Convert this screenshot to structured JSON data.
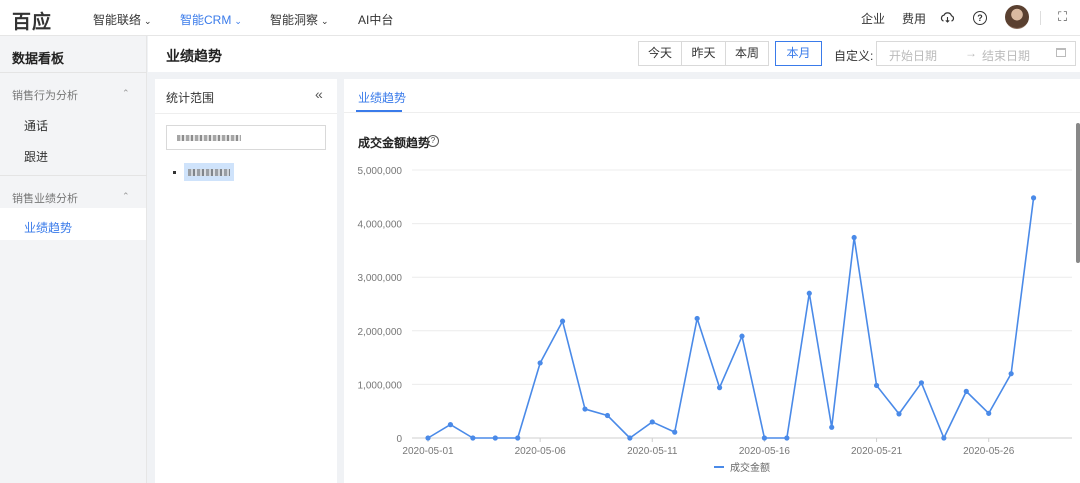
{
  "topbar": {
    "logo": "百应",
    "nav": [
      {
        "label": "智能联络",
        "active": false,
        "has_dropdown": true
      },
      {
        "label": "智能CRM",
        "active": true,
        "has_dropdown": true
      },
      {
        "label": "智能洞察",
        "active": false,
        "has_dropdown": true
      },
      {
        "label": "AI中台",
        "active": false,
        "has_dropdown": false
      }
    ],
    "right": {
      "enterprise": "企业",
      "fees": "费用",
      "icons": [
        "cloud-icon",
        "help-icon",
        "avatar",
        "expand-icon"
      ]
    }
  },
  "sidebar": {
    "title": "数据看板",
    "groups": [
      {
        "label": "销售行为分析",
        "items": [
          {
            "label": "通话",
            "active": false
          },
          {
            "label": "跟进",
            "active": false
          }
        ]
      },
      {
        "label": "销售业绩分析",
        "items": [
          {
            "label": "业绩趋势",
            "active": true
          }
        ]
      }
    ]
  },
  "header": {
    "title": "业绩趋势",
    "periods": [
      {
        "label": "今天",
        "active": false
      },
      {
        "label": "昨天",
        "active": false
      },
      {
        "label": "本周",
        "active": false
      },
      {
        "label": "本月",
        "active": true
      }
    ],
    "custom_label": "自定义:",
    "date_start_placeholder": "开始日期",
    "range_arrow": "→",
    "date_end_placeholder": "结束日期"
  },
  "left_panel": {
    "title": "统计范围",
    "collapse_icon": "«"
  },
  "right_panel": {
    "tab": "业绩趋势",
    "chart_title": "成交金额趋势",
    "help_icon": "?"
  },
  "colors": {
    "accent": "#3a7bea",
    "line": "#4a8ae8"
  },
  "chart_data": {
    "type": "line",
    "title": "成交金额趋势",
    "xlabel": "",
    "ylabel": "",
    "x": [
      "2020-05-01",
      "2020-05-02",
      "2020-05-03",
      "2020-05-04",
      "2020-05-05",
      "2020-05-06",
      "2020-05-07",
      "2020-05-08",
      "2020-05-09",
      "2020-05-10",
      "2020-05-11",
      "2020-05-12",
      "2020-05-13",
      "2020-05-14",
      "2020-05-15",
      "2020-05-16",
      "2020-05-17",
      "2020-05-18",
      "2020-05-19",
      "2020-05-20",
      "2020-05-21",
      "2020-05-22",
      "2020-05-23",
      "2020-05-24",
      "2020-05-25",
      "2020-05-26",
      "2020-05-27",
      "2020-05-28",
      "2020-05-29"
    ],
    "x_tick_labels": [
      "2020-05-01",
      "2020-05-06",
      "2020-05-11",
      "2020-05-16",
      "2020-05-21",
      "2020-05-26"
    ],
    "series": [
      {
        "name": "成交金额",
        "values": [
          0,
          250000,
          0,
          0,
          0,
          1400000,
          2180000,
          540000,
          420000,
          0,
          300000,
          110000,
          2230000,
          940000,
          1900000,
          0,
          0,
          2700000,
          200000,
          3740000,
          980000,
          450000,
          1030000,
          0,
          870000,
          460000,
          1200000,
          4480000
        ]
      }
    ],
    "ylim": [
      0,
      5000000
    ],
    "y_ticks": [
      0,
      1000000,
      2000000,
      3000000,
      4000000,
      5000000
    ],
    "y_tick_labels": [
      "0",
      "1,000,000",
      "2,000,000",
      "3,000,000",
      "4,000,000",
      "5,000,000"
    ],
    "grid": true,
    "legend": "bottom"
  }
}
